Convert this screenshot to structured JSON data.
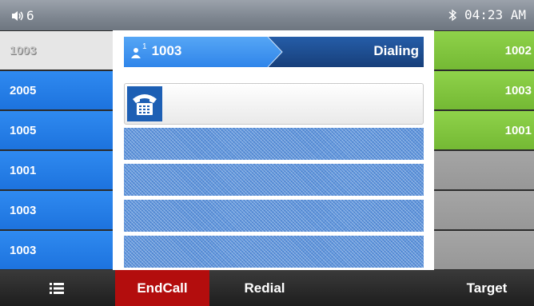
{
  "status_bar": {
    "volume_level": "6",
    "time": "04:23 AM"
  },
  "left_keys": [
    {
      "label": "1003",
      "active": true
    },
    {
      "label": "2005"
    },
    {
      "label": "1005"
    },
    {
      "label": "1001"
    },
    {
      "label": "1003"
    },
    {
      "label": "1003"
    }
  ],
  "right_keys": [
    {
      "label": "1002"
    },
    {
      "label": "1003"
    },
    {
      "label": "1001"
    },
    {
      "label": ""
    },
    {
      "label": ""
    },
    {
      "label": ""
    }
  ],
  "dial": {
    "account_superscript": "1",
    "number": "1003",
    "state": "Dialing",
    "input_value": ""
  },
  "softkeys": {
    "menu_icon": "list-icon",
    "endcall": "EndCall",
    "redial": "Redial",
    "target": "Target"
  },
  "colors": {
    "line_blue": "#1d73de",
    "blf_green": "#74b934",
    "endcall_red": "#b30d0d",
    "header_dark_blue": "#1a4c8f",
    "header_light_blue": "#3a8fee"
  }
}
